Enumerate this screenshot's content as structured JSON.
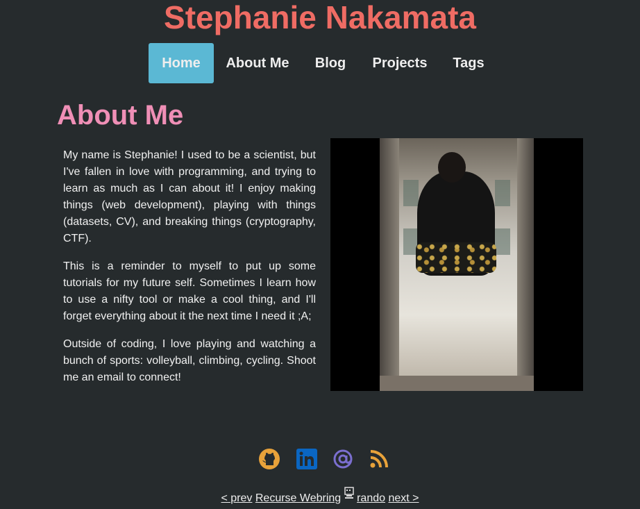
{
  "site": {
    "title": "Stephanie Nakamata"
  },
  "nav": {
    "items": [
      {
        "label": "Home",
        "active": true
      },
      {
        "label": "About Me",
        "active": false
      },
      {
        "label": "Blog",
        "active": false
      },
      {
        "label": "Projects",
        "active": false
      },
      {
        "label": "Tags",
        "active": false
      }
    ]
  },
  "page": {
    "heading": "About Me",
    "paragraphs": [
      "My name is Stephanie! I used to be a scientist, but I've fallen in love with programming, and trying to learn as much as I can about it! I enjoy making things (web development), playing with things (datasets, CV), and breaking things (cryptography, CTF).",
      "This is a reminder to myself to put up some tutorials for my future self. Sometimes I learn how to use a nifty tool or make a cool thing, and I'll forget everything about it the next time I need it ;A;",
      "Outside of coding, I love playing and watching a bunch of sports: volleyball, climbing, cycling. Shoot me an email to connect!"
    ],
    "photo_icon": "portrait-photo"
  },
  "footer": {
    "icons": [
      "github-icon",
      "linkedin-icon",
      "email-at-icon",
      "rss-icon"
    ],
    "colors": {
      "github": "#e8a23a",
      "linkedin": "#0a66c2",
      "email": "#7b6fd0",
      "rss": "#e8a23a"
    },
    "webring": {
      "prev": "< prev",
      "name": "Recurse Webring",
      "rando": "rando",
      "next": "next >"
    }
  },
  "colors": {
    "background": "#262b2d",
    "title": "#ef6c64",
    "heading": "#ef8fb6",
    "nav_active": "#5bb8d4"
  }
}
